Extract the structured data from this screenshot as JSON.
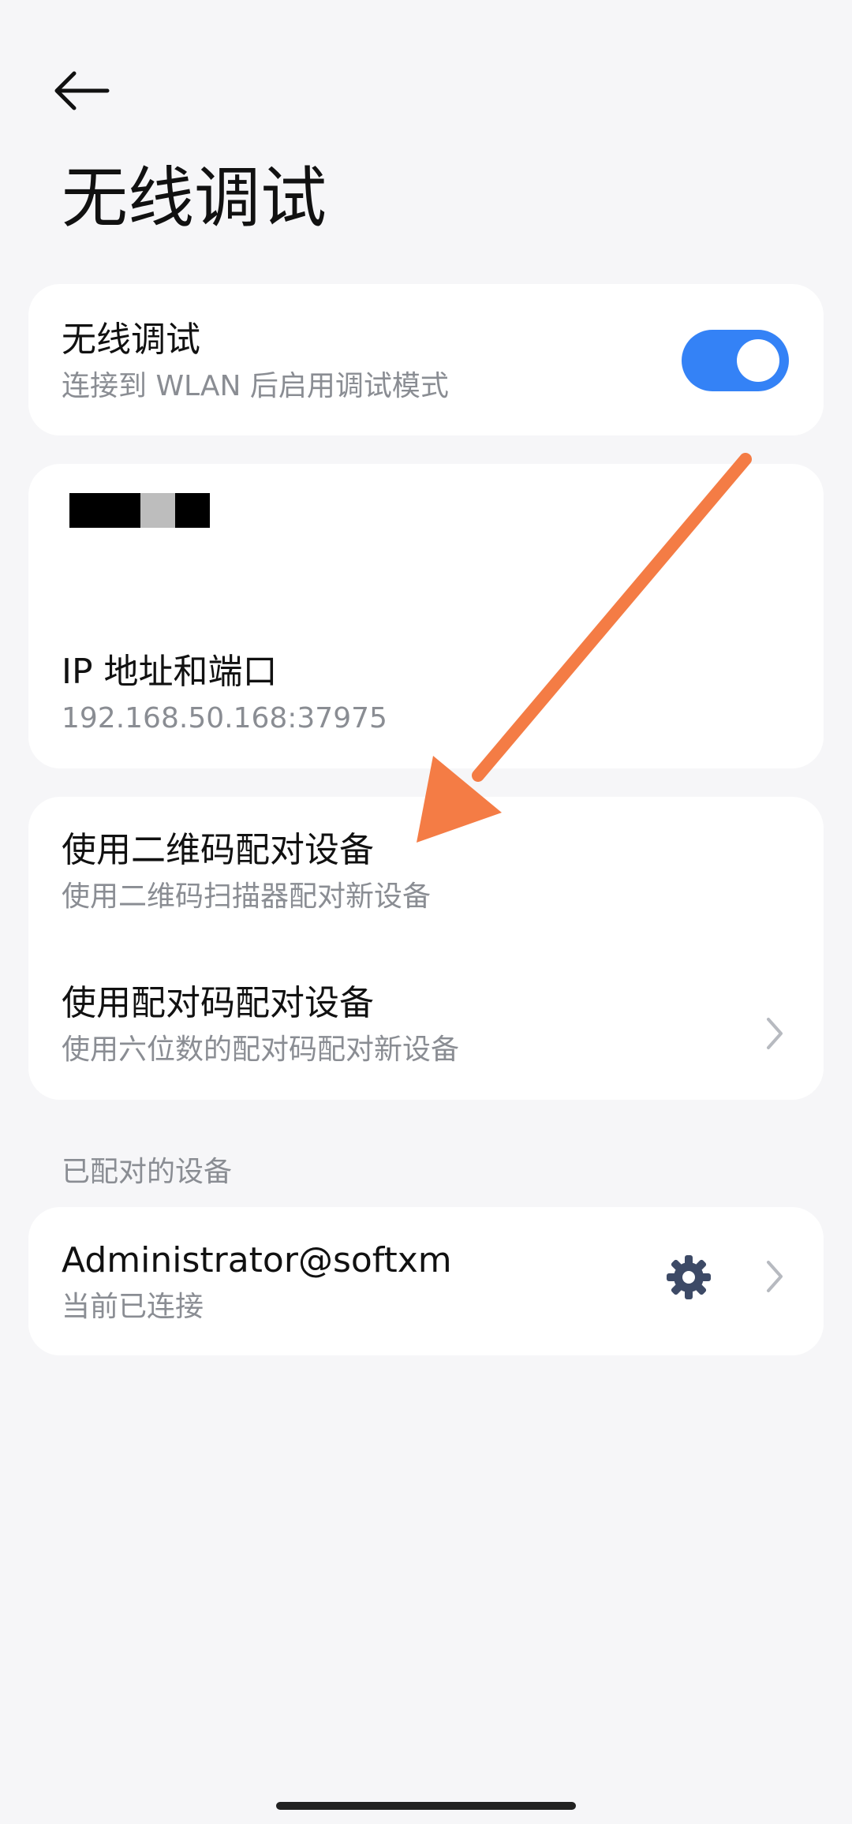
{
  "header": {
    "back_icon": "arrow-left-icon",
    "title": "无线调试"
  },
  "wireless_debug": {
    "title": "无线调试",
    "subtitle": "连接到 WLAN 后启用调试模式",
    "enabled": true,
    "accent": "#3482f6"
  },
  "network": {
    "redacted_name": "",
    "ip_label": "IP 地址和端口",
    "ip_value": "192.168.50.168:37975"
  },
  "pairing": {
    "qr_title": "使用二维码配对设备",
    "qr_subtitle": "使用二维码扫描器配对新设备",
    "code_title": "使用配对码配对设备",
    "code_subtitle": "使用六位数的配对码配对新设备"
  },
  "paired_section": {
    "label": "已配对的设备",
    "device_name": "Administrator@softxm",
    "device_status": "当前已连接"
  },
  "annotation": {
    "arrow_color": "#f47c45"
  }
}
